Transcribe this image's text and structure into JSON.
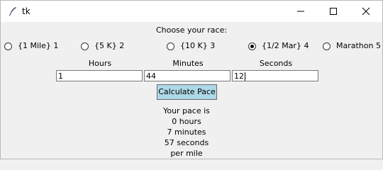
{
  "window": {
    "title": "tk"
  },
  "prompt": "Choose your race:",
  "races": [
    {
      "label": "{1 Mile} 1",
      "selected": false
    },
    {
      "label": "{5 K} 2",
      "selected": false
    },
    {
      "label": "{10 K} 3",
      "selected": false
    },
    {
      "label": "{1/2 Mar} 4",
      "selected": true
    },
    {
      "label": "Marathon 5",
      "selected": false
    }
  ],
  "fields": {
    "hours": {
      "label": "Hours",
      "value": "1"
    },
    "minutes": {
      "label": "Minutes",
      "value": "44"
    },
    "seconds": {
      "label": "Seconds",
      "value": "12"
    }
  },
  "calculate_label": "Calculate Pace",
  "result": {
    "line1": "Your pace is",
    "line2": "0 hours",
    "line3": "7 minutes",
    "line4": "57 seconds",
    "line5": "per mile"
  }
}
